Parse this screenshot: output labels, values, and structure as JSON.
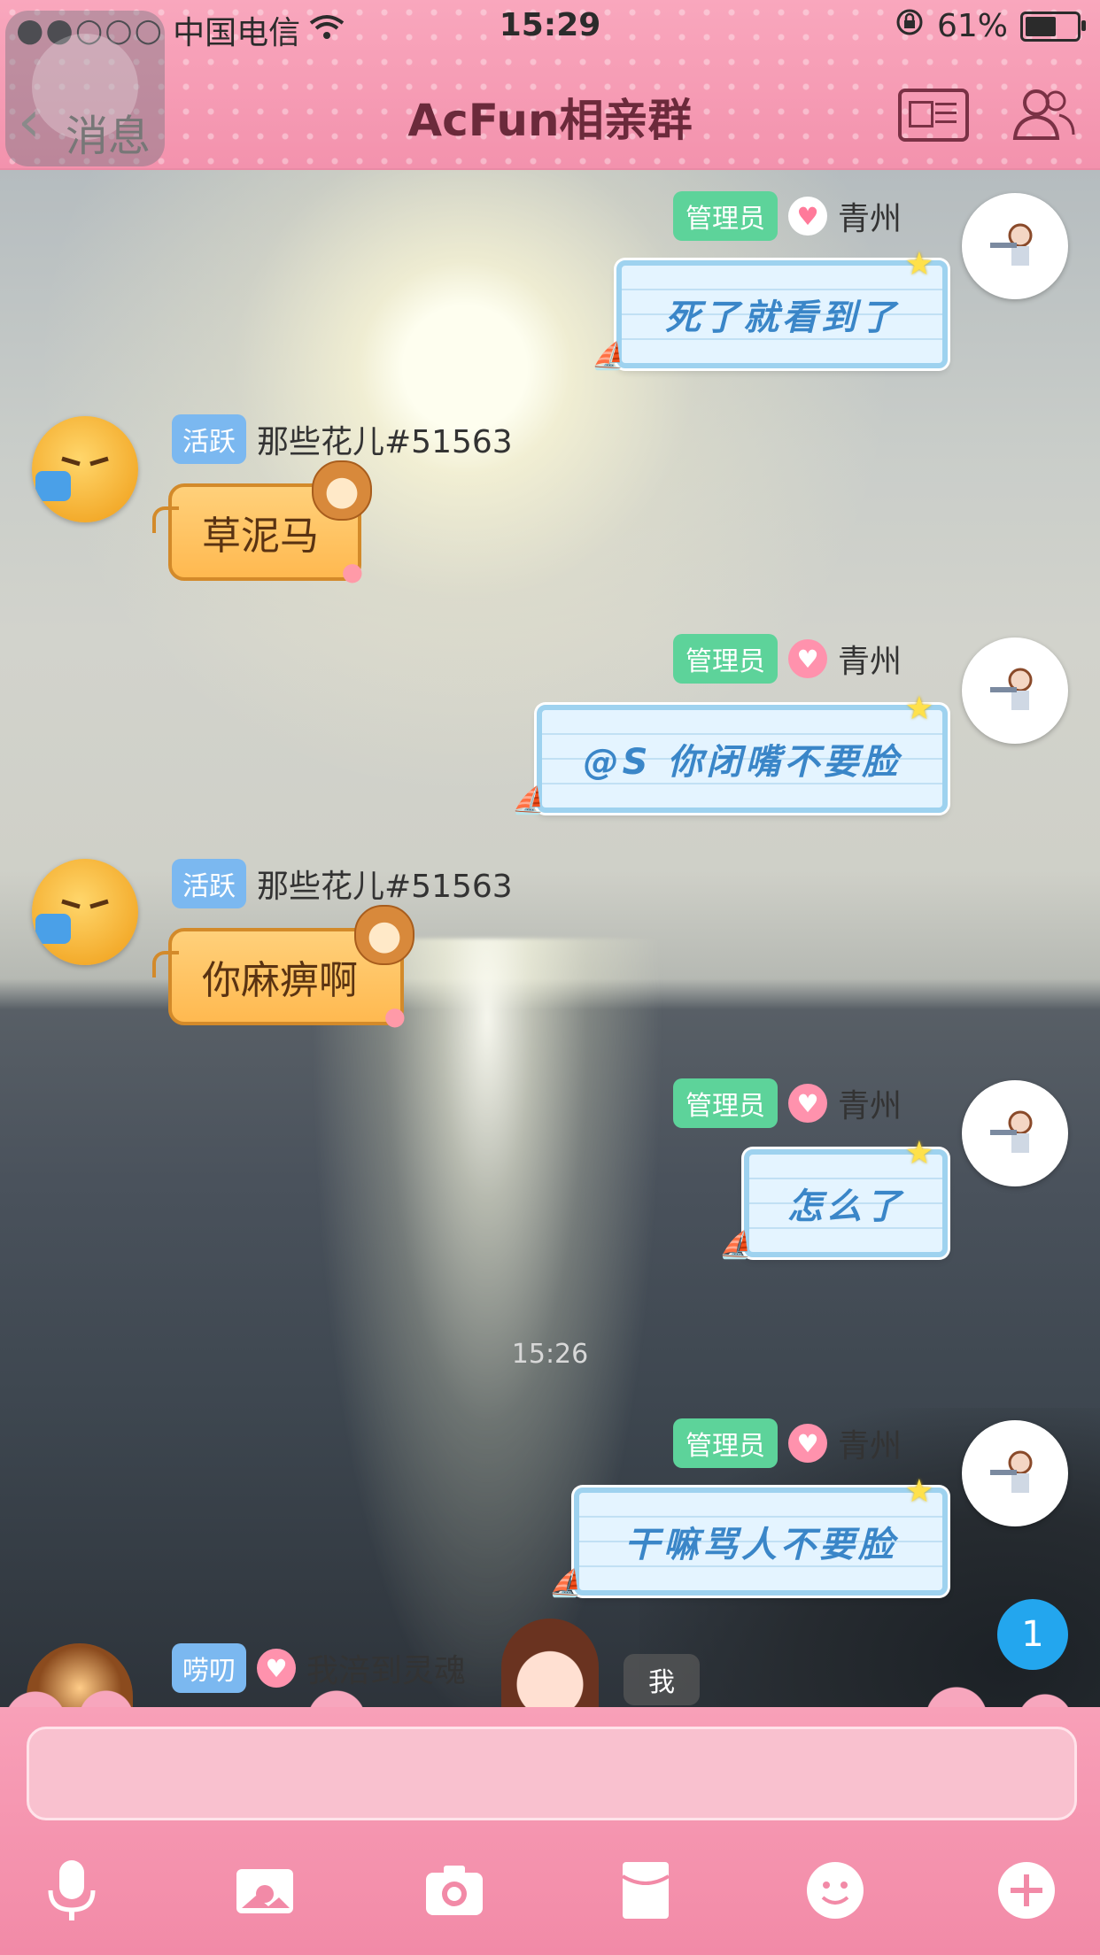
{
  "status_bar": {
    "signal": "●●○○○",
    "carrier": "中国电信",
    "time": "15:29",
    "battery_percent": "61%",
    "battery_level": 0.61
  },
  "header": {
    "back_label": "消息",
    "title": "AcFun相亲群"
  },
  "messages": [
    {
      "side": "right",
      "tag": "管理员",
      "name": "青州",
      "text": "死了就看到了"
    },
    {
      "side": "left",
      "tag": "活跃",
      "name": "那些花儿#51563",
      "text": "草泥马"
    },
    {
      "side": "right",
      "tag": "管理员",
      "name": "青州",
      "text": "@S 你闭嘴不要脸"
    },
    {
      "side": "left",
      "tag": "活跃",
      "name": "那些花儿#51563",
      "text": "你麻痹啊"
    },
    {
      "side": "right",
      "tag": "管理员",
      "name": "青州",
      "text": "怎么了"
    },
    {
      "side": "right",
      "tag": "管理员",
      "name": "青州",
      "text": "干嘛骂人不要脸"
    }
  ],
  "timestamp": "15:26",
  "partial_message": {
    "tag": "唠叨",
    "name": "我涪到灵魂"
  },
  "unread_count": "1",
  "me_label": "我",
  "toolbar": [
    "microphone-icon",
    "image-icon",
    "camera-icon",
    "red-envelope-icon",
    "emoji-icon",
    "plus-icon"
  ],
  "colors": {
    "header_pink": "#f392ad",
    "admin_green": "#5dd39a",
    "active_blue": "#7bb8f0",
    "unread_blue": "#23a6ee"
  }
}
